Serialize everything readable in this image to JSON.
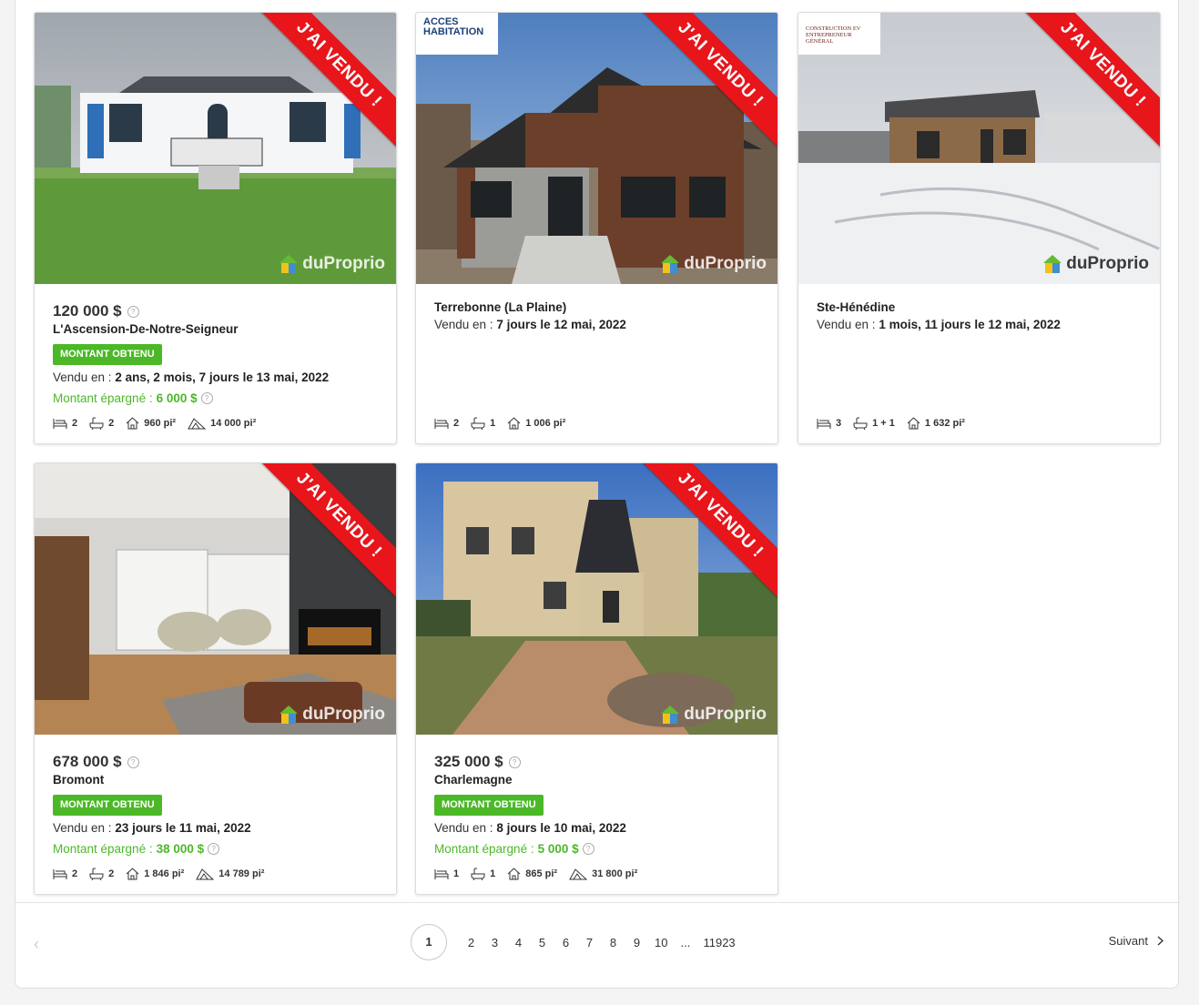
{
  "cards": [
    {
      "ribbon": "J'AI VENDU !",
      "price": "120 000 $",
      "city": "L'Ascension-De-Notre-Seigneur",
      "badge": "MONTANT OBTENU",
      "sold_prefix": "Vendu en : ",
      "sold_value": "2 ans, 2 mois, 7 jours le 13 mai, 2022",
      "saved_prefix": "Montant épargné :",
      "saved_value": "6 000 $",
      "feats": {
        "beds": "2",
        "baths": "2",
        "area": "960 pi²",
        "lot": "14 000 pi²"
      },
      "logo": "duProprio"
    },
    {
      "ribbon": "J'AI VENDU !",
      "city": "Terrebonne (La Plaine)",
      "sold_prefix": "Vendu en : ",
      "sold_value": "7 jours le 12 mai, 2022",
      "feats": {
        "beds": "2",
        "baths": "1",
        "area": "1 006 pi²"
      },
      "builder": "ACCES HABITATION",
      "logo": "duProprio"
    },
    {
      "ribbon": "J'AI VENDU !",
      "city": "Ste-Hénédine",
      "sold_prefix": "Vendu en : ",
      "sold_value": "1 mois, 11 jours le 12 mai, 2022",
      "feats": {
        "beds": "3",
        "baths": "1 + 1",
        "area": "1 632 pi²"
      },
      "builder": "CONSTRUCTION EV ENTREPRENEUR GÉNÉRAL",
      "logo": "duProprio"
    },
    {
      "ribbon": "J'AI VENDU !",
      "price": "678 000 $",
      "city": "Bromont",
      "badge": "MONTANT OBTENU",
      "sold_prefix": "Vendu en : ",
      "sold_value": "23 jours le 11 mai, 2022",
      "saved_prefix": "Montant épargné :",
      "saved_value": "38 000 $",
      "feats": {
        "beds": "2",
        "baths": "2",
        "area": "1 846 pi²",
        "lot": "14 789 pi²"
      },
      "logo": "duProprio"
    },
    {
      "ribbon": "J'AI VENDU !",
      "price": "325 000 $",
      "city": "Charlemagne",
      "badge": "MONTANT OBTENU",
      "sold_prefix": "Vendu en : ",
      "sold_value": "8 jours le 10 mai, 2022",
      "saved_prefix": "Montant épargné :",
      "saved_value": "5 000 $",
      "feats": {
        "beds": "1",
        "baths": "1",
        "area": "865 pi²",
        "lot": "31 800 pi²"
      },
      "logo": "duProprio"
    }
  ],
  "pagination": {
    "pages": [
      "1",
      "2",
      "3",
      "4",
      "5",
      "6",
      "7",
      "8",
      "9",
      "10",
      "...",
      "11923"
    ],
    "current": "1",
    "next_label": "Suivant"
  },
  "colors": {
    "ribbon": "#e8151b",
    "badge": "#4cb828",
    "saved_text": "#4cb828"
  }
}
